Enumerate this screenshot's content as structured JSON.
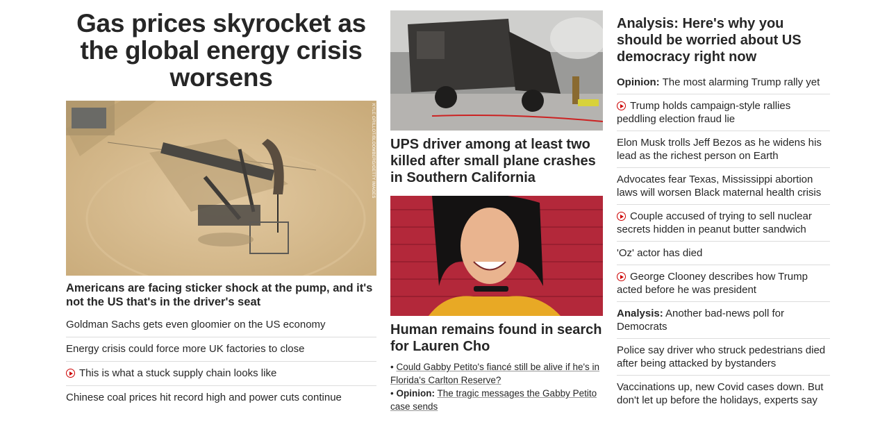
{
  "col1": {
    "headline": "Gas prices skyrocket as the global energy crisis worsens",
    "image_credit": "KYLE GRILLOT/BLOOMBERG/GETTY IMAGES",
    "caption": "Americans are facing sticker shock at the pump, and it's not the US that's in the driver's seat",
    "links": [
      {
        "text": "Goldman Sachs gets even gloomier on the US economy",
        "video": false
      },
      {
        "text": "Energy crisis could force more UK factories to close",
        "video": false
      },
      {
        "text": "This is what a stuck supply chain looks like",
        "video": true
      },
      {
        "text": "Chinese coal prices hit record high and power cuts continue",
        "video": false
      }
    ]
  },
  "col2": {
    "story1": "UPS driver among at least two killed after small plane crashes in Southern California",
    "story2": "Human remains found in search for Lauren Cho",
    "sub1": "Could Gabby Petito's fiancé still be alive if he's in Florida's Carlton Reserve?",
    "sub2_label": "Opinion:",
    "sub2_text": "The tragic messages the Gabby Petito case sends"
  },
  "col3": {
    "analysis_head": "Analysis: Here's why you should be worried about US democracy right now",
    "links": [
      {
        "label": "Opinion:",
        "text": "The most alarming Trump rally yet",
        "video": false
      },
      {
        "label": "",
        "text": "Trump holds campaign-style rallies peddling election fraud lie",
        "video": true
      },
      {
        "label": "",
        "text": "Elon Musk trolls Jeff Bezos as he widens his lead as the richest person on Earth",
        "video": false
      },
      {
        "label": "",
        "text": "Advocates fear Texas, Mississippi abortion laws will worsen Black maternal health crisis",
        "video": false
      },
      {
        "label": "",
        "text": "Couple accused of trying to sell nuclear secrets hidden in peanut butter sandwich",
        "video": true
      },
      {
        "label": "",
        "text": "'Oz' actor has died",
        "video": false
      },
      {
        "label": "",
        "text": "George Clooney describes how Trump acted before he was president",
        "video": true
      },
      {
        "label": "Analysis:",
        "text": "Another bad-news poll for Democrats",
        "video": false
      },
      {
        "label": "",
        "text": "Police say driver who struck pedestrians died after being attacked by bystanders",
        "video": false
      },
      {
        "label": "",
        "text": "Vaccinations up, new Covid cases down. But don't let up before the holidays, experts say",
        "video": false
      }
    ]
  },
  "colors": {
    "play_red": "#cc0000",
    "text": "#262626",
    "divider": "#dcdcdc"
  }
}
